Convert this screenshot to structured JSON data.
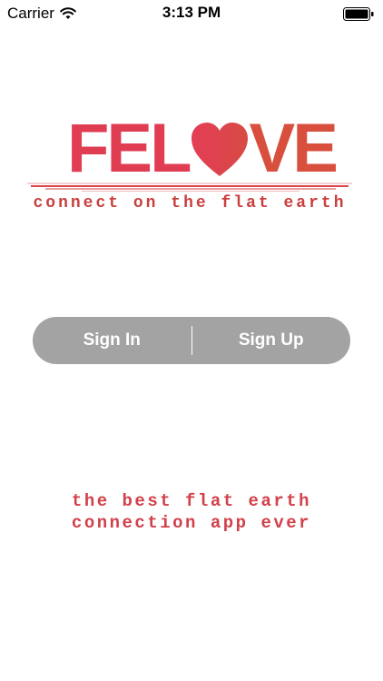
{
  "status_bar": {
    "carrier": "Carrier",
    "time": "3:13 PM",
    "wifi_icon": "wifi-icon",
    "battery_icon": "battery-icon"
  },
  "logo": {
    "word_part1": "FEL",
    "heart_icon": "heart-icon",
    "word_part2": "VE",
    "tagline": "connect on the flat earth",
    "colors": {
      "primary": "#e03c52",
      "secondary": "#d94f3d"
    }
  },
  "auth": {
    "sign_in_label": "Sign In",
    "sign_up_label": "Sign Up",
    "segment_color": "#a3a3a3"
  },
  "slogan": {
    "line1": "the best flat earth",
    "line2": "connection app ever"
  }
}
